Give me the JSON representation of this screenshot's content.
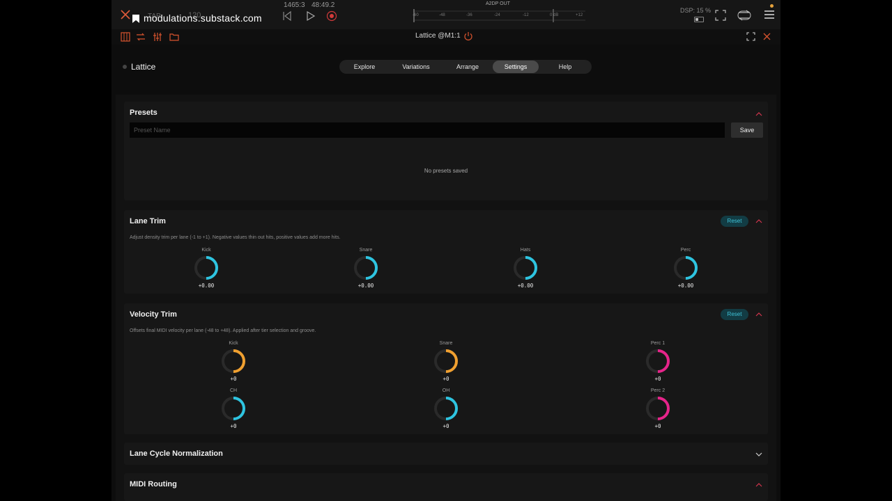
{
  "topbar": {
    "url": "modulations.substack.com",
    "tap": "TAP",
    "tempo": "120",
    "position": "1465:3",
    "time": "48:49.2",
    "meter_title": "A2DP OUT",
    "meter_ticks": [
      "-60",
      "-48",
      "-36",
      "-24",
      "-12",
      "0 dB",
      "+12"
    ],
    "dsp": "DSP: 15 %"
  },
  "plugin": {
    "title": "Lattice @M1:1",
    "brand": "Lattice"
  },
  "tabs": [
    {
      "label": "Explore",
      "active": false
    },
    {
      "label": "Variations",
      "active": false
    },
    {
      "label": "Arrange",
      "active": false
    },
    {
      "label": "Settings",
      "active": true
    },
    {
      "label": "Help",
      "active": false
    }
  ],
  "presets": {
    "title": "Presets",
    "placeholder": "Preset Name",
    "save_label": "Save",
    "empty_text": "No presets saved"
  },
  "lane_trim": {
    "title": "Lane Trim",
    "reset_label": "Reset",
    "description": "Adjust density trim per lane (-1 to +1). Negative values thin out hits, positive values add more hits.",
    "knobs": [
      {
        "label": "Kick",
        "value": "+0.00"
      },
      {
        "label": "Snare",
        "value": "+0.00"
      },
      {
        "label": "Hats",
        "value": "+0.00"
      },
      {
        "label": "Perc",
        "value": "+0.00"
      }
    ]
  },
  "velocity_trim": {
    "title": "Velocity Trim",
    "reset_label": "Reset",
    "description": "Offsets final MIDI velocity per lane (-48 to +48). Applied after tier selection and groove.",
    "knobs": [
      {
        "label": "Kick",
        "value": "+0",
        "color": "#f0a030"
      },
      {
        "label": "Snare",
        "value": "+0",
        "color": "#f0a030"
      },
      {
        "label": "Perc 1",
        "value": "+0",
        "color": "#e6248a"
      },
      {
        "label": "CH",
        "value": "+0",
        "color": "#2ec4e0"
      },
      {
        "label": "OH",
        "value": "+0",
        "color": "#2ec4e0"
      },
      {
        "label": "Perc 2",
        "value": "+0",
        "color": "#e6248a"
      }
    ]
  },
  "lane_cycle": {
    "title": "Lane Cycle Normalization"
  },
  "midi_routing": {
    "title": "MIDI Routing"
  },
  "colors": {
    "accent_cyan": "#2ec4e0",
    "accent_orange": "#f0a030",
    "accent_magenta": "#e6248a",
    "chevron_red": "#d4364e"
  }
}
